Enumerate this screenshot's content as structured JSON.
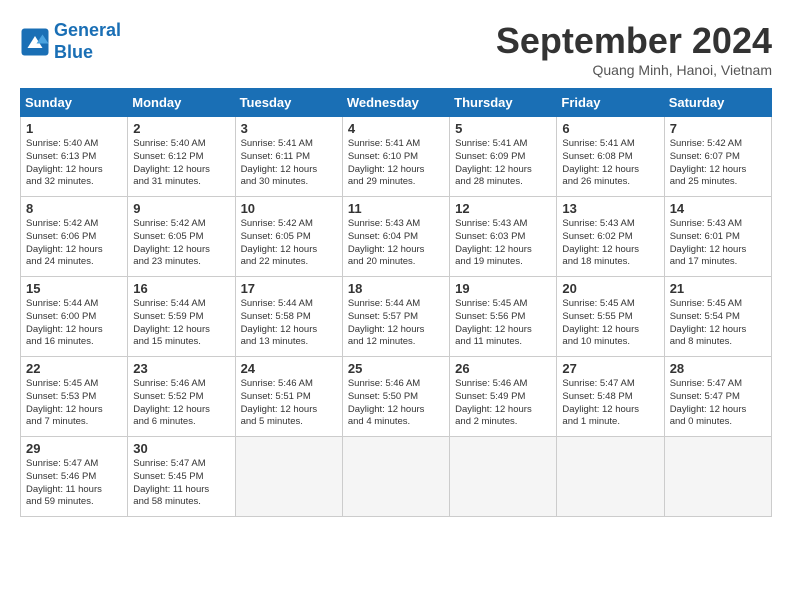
{
  "header": {
    "logo_line1": "General",
    "logo_line2": "Blue",
    "month": "September 2024",
    "location": "Quang Minh, Hanoi, Vietnam"
  },
  "columns": [
    "Sunday",
    "Monday",
    "Tuesday",
    "Wednesday",
    "Thursday",
    "Friday",
    "Saturday"
  ],
  "rows": [
    [
      {
        "day": "1",
        "lines": [
          "Sunrise: 5:40 AM",
          "Sunset: 6:13 PM",
          "Daylight: 12 hours",
          "and 32 minutes."
        ]
      },
      {
        "day": "2",
        "lines": [
          "Sunrise: 5:40 AM",
          "Sunset: 6:12 PM",
          "Daylight: 12 hours",
          "and 31 minutes."
        ]
      },
      {
        "day": "3",
        "lines": [
          "Sunrise: 5:41 AM",
          "Sunset: 6:11 PM",
          "Daylight: 12 hours",
          "and 30 minutes."
        ]
      },
      {
        "day": "4",
        "lines": [
          "Sunrise: 5:41 AM",
          "Sunset: 6:10 PM",
          "Daylight: 12 hours",
          "and 29 minutes."
        ]
      },
      {
        "day": "5",
        "lines": [
          "Sunrise: 5:41 AM",
          "Sunset: 6:09 PM",
          "Daylight: 12 hours",
          "and 28 minutes."
        ]
      },
      {
        "day": "6",
        "lines": [
          "Sunrise: 5:41 AM",
          "Sunset: 6:08 PM",
          "Daylight: 12 hours",
          "and 26 minutes."
        ]
      },
      {
        "day": "7",
        "lines": [
          "Sunrise: 5:42 AM",
          "Sunset: 6:07 PM",
          "Daylight: 12 hours",
          "and 25 minutes."
        ]
      }
    ],
    [
      {
        "day": "8",
        "lines": [
          "Sunrise: 5:42 AM",
          "Sunset: 6:06 PM",
          "Daylight: 12 hours",
          "and 24 minutes."
        ]
      },
      {
        "day": "9",
        "lines": [
          "Sunrise: 5:42 AM",
          "Sunset: 6:05 PM",
          "Daylight: 12 hours",
          "and 23 minutes."
        ]
      },
      {
        "day": "10",
        "lines": [
          "Sunrise: 5:42 AM",
          "Sunset: 6:05 PM",
          "Daylight: 12 hours",
          "and 22 minutes."
        ]
      },
      {
        "day": "11",
        "lines": [
          "Sunrise: 5:43 AM",
          "Sunset: 6:04 PM",
          "Daylight: 12 hours",
          "and 20 minutes."
        ]
      },
      {
        "day": "12",
        "lines": [
          "Sunrise: 5:43 AM",
          "Sunset: 6:03 PM",
          "Daylight: 12 hours",
          "and 19 minutes."
        ]
      },
      {
        "day": "13",
        "lines": [
          "Sunrise: 5:43 AM",
          "Sunset: 6:02 PM",
          "Daylight: 12 hours",
          "and 18 minutes."
        ]
      },
      {
        "day": "14",
        "lines": [
          "Sunrise: 5:43 AM",
          "Sunset: 6:01 PM",
          "Daylight: 12 hours",
          "and 17 minutes."
        ]
      }
    ],
    [
      {
        "day": "15",
        "lines": [
          "Sunrise: 5:44 AM",
          "Sunset: 6:00 PM",
          "Daylight: 12 hours",
          "and 16 minutes."
        ]
      },
      {
        "day": "16",
        "lines": [
          "Sunrise: 5:44 AM",
          "Sunset: 5:59 PM",
          "Daylight: 12 hours",
          "and 15 minutes."
        ]
      },
      {
        "day": "17",
        "lines": [
          "Sunrise: 5:44 AM",
          "Sunset: 5:58 PM",
          "Daylight: 12 hours",
          "and 13 minutes."
        ]
      },
      {
        "day": "18",
        "lines": [
          "Sunrise: 5:44 AM",
          "Sunset: 5:57 PM",
          "Daylight: 12 hours",
          "and 12 minutes."
        ]
      },
      {
        "day": "19",
        "lines": [
          "Sunrise: 5:45 AM",
          "Sunset: 5:56 PM",
          "Daylight: 12 hours",
          "and 11 minutes."
        ]
      },
      {
        "day": "20",
        "lines": [
          "Sunrise: 5:45 AM",
          "Sunset: 5:55 PM",
          "Daylight: 12 hours",
          "and 10 minutes."
        ]
      },
      {
        "day": "21",
        "lines": [
          "Sunrise: 5:45 AM",
          "Sunset: 5:54 PM",
          "Daylight: 12 hours",
          "and 8 minutes."
        ]
      }
    ],
    [
      {
        "day": "22",
        "lines": [
          "Sunrise: 5:45 AM",
          "Sunset: 5:53 PM",
          "Daylight: 12 hours",
          "and 7 minutes."
        ]
      },
      {
        "day": "23",
        "lines": [
          "Sunrise: 5:46 AM",
          "Sunset: 5:52 PM",
          "Daylight: 12 hours",
          "and 6 minutes."
        ]
      },
      {
        "day": "24",
        "lines": [
          "Sunrise: 5:46 AM",
          "Sunset: 5:51 PM",
          "Daylight: 12 hours",
          "and 5 minutes."
        ]
      },
      {
        "day": "25",
        "lines": [
          "Sunrise: 5:46 AM",
          "Sunset: 5:50 PM",
          "Daylight: 12 hours",
          "and 4 minutes."
        ]
      },
      {
        "day": "26",
        "lines": [
          "Sunrise: 5:46 AM",
          "Sunset: 5:49 PM",
          "Daylight: 12 hours",
          "and 2 minutes."
        ]
      },
      {
        "day": "27",
        "lines": [
          "Sunrise: 5:47 AM",
          "Sunset: 5:48 PM",
          "Daylight: 12 hours",
          "and 1 minute."
        ]
      },
      {
        "day": "28",
        "lines": [
          "Sunrise: 5:47 AM",
          "Sunset: 5:47 PM",
          "Daylight: 12 hours",
          "and 0 minutes."
        ]
      }
    ],
    [
      {
        "day": "29",
        "lines": [
          "Sunrise: 5:47 AM",
          "Sunset: 5:46 PM",
          "Daylight: 11 hours",
          "and 59 minutes."
        ]
      },
      {
        "day": "30",
        "lines": [
          "Sunrise: 5:47 AM",
          "Sunset: 5:45 PM",
          "Daylight: 11 hours",
          "and 58 minutes."
        ]
      },
      {
        "day": "",
        "lines": []
      },
      {
        "day": "",
        "lines": []
      },
      {
        "day": "",
        "lines": []
      },
      {
        "day": "",
        "lines": []
      },
      {
        "day": "",
        "lines": []
      }
    ]
  ]
}
